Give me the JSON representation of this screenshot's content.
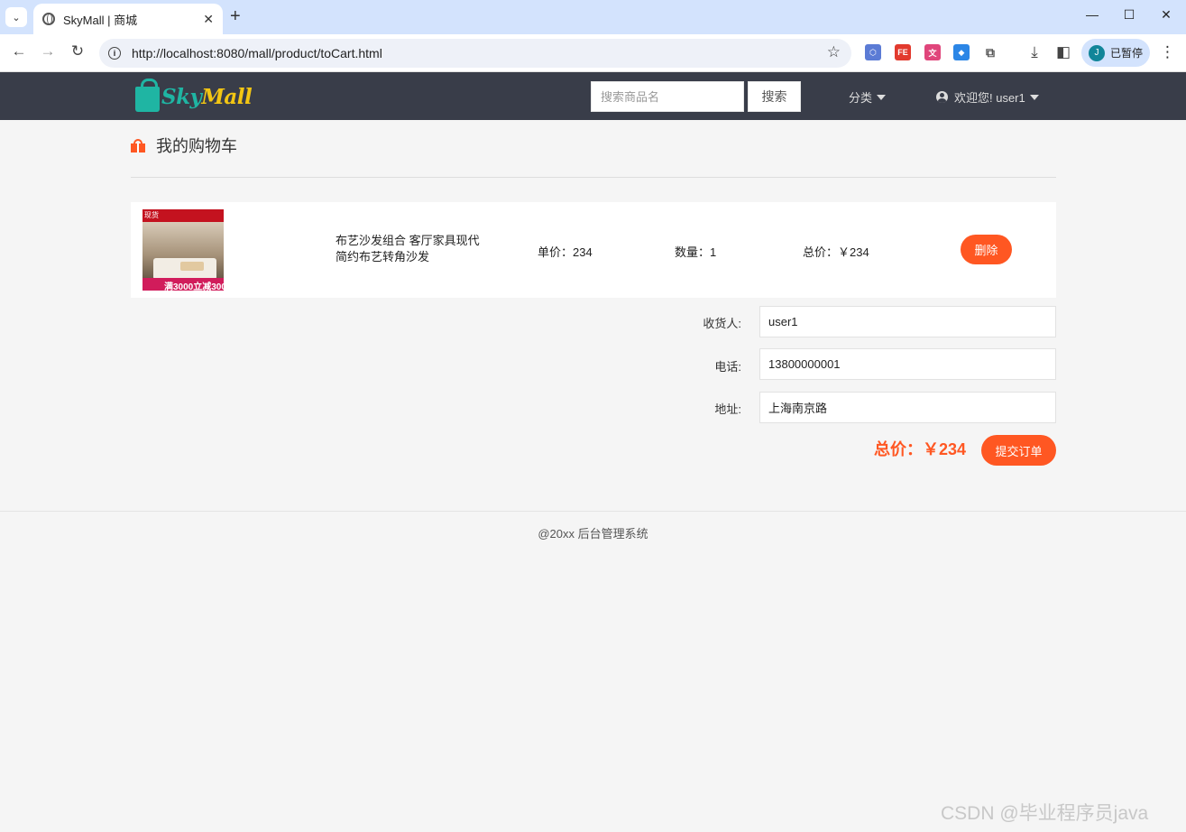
{
  "browser": {
    "tab_title": "SkyMall | 商城",
    "url": "http://localhost:8080/mall/product/toCart.html",
    "profile_initial": "J",
    "profile_label": "已暂停",
    "extensions": [
      {
        "name": "extension-hexagon-icon",
        "color": "#5b7bd5"
      },
      {
        "name": "extension-fe-icon",
        "color": "#e23a2e"
      },
      {
        "name": "extension-translate-icon",
        "color": "#e0457b"
      },
      {
        "name": "extension-shield-icon",
        "color": "#2b86e6"
      },
      {
        "name": "extensions-puzzle-icon",
        "color": "#555555"
      }
    ]
  },
  "header": {
    "logo_part1": "Sky",
    "logo_part2": "Mall",
    "search_placeholder": "搜索商品名",
    "search_button": "搜索",
    "category_label": "分类",
    "user_greeting": "欢迎您! user1"
  },
  "page": {
    "title": "我的购物车"
  },
  "cart": {
    "items": [
      {
        "thumb_top": "现货",
        "thumb_promo": "满3000立减300",
        "name": "布艺沙发组合 客厅家具现代简约布艺转角沙发",
        "unit_price": "单价：234",
        "quantity": "数量：1",
        "subtotal": "总价：￥234",
        "delete_label": "删除"
      }
    ]
  },
  "form": {
    "receiver_label": "收货人:",
    "receiver_value": "user1",
    "phone_label": "电话:",
    "phone_value": "13800000001",
    "address_label": "地址:",
    "address_value": "上海南京路"
  },
  "order": {
    "total": "总价：￥234",
    "submit_label": "提交订单"
  },
  "footer": {
    "text": "@20xx  后台管理系统"
  },
  "watermark": "CSDN @毕业程序员java",
  "colors": {
    "accent": "#ff5722",
    "header_bg": "#393d49",
    "logo_teal": "#1fb5a3",
    "logo_yellow": "#f3c613"
  }
}
